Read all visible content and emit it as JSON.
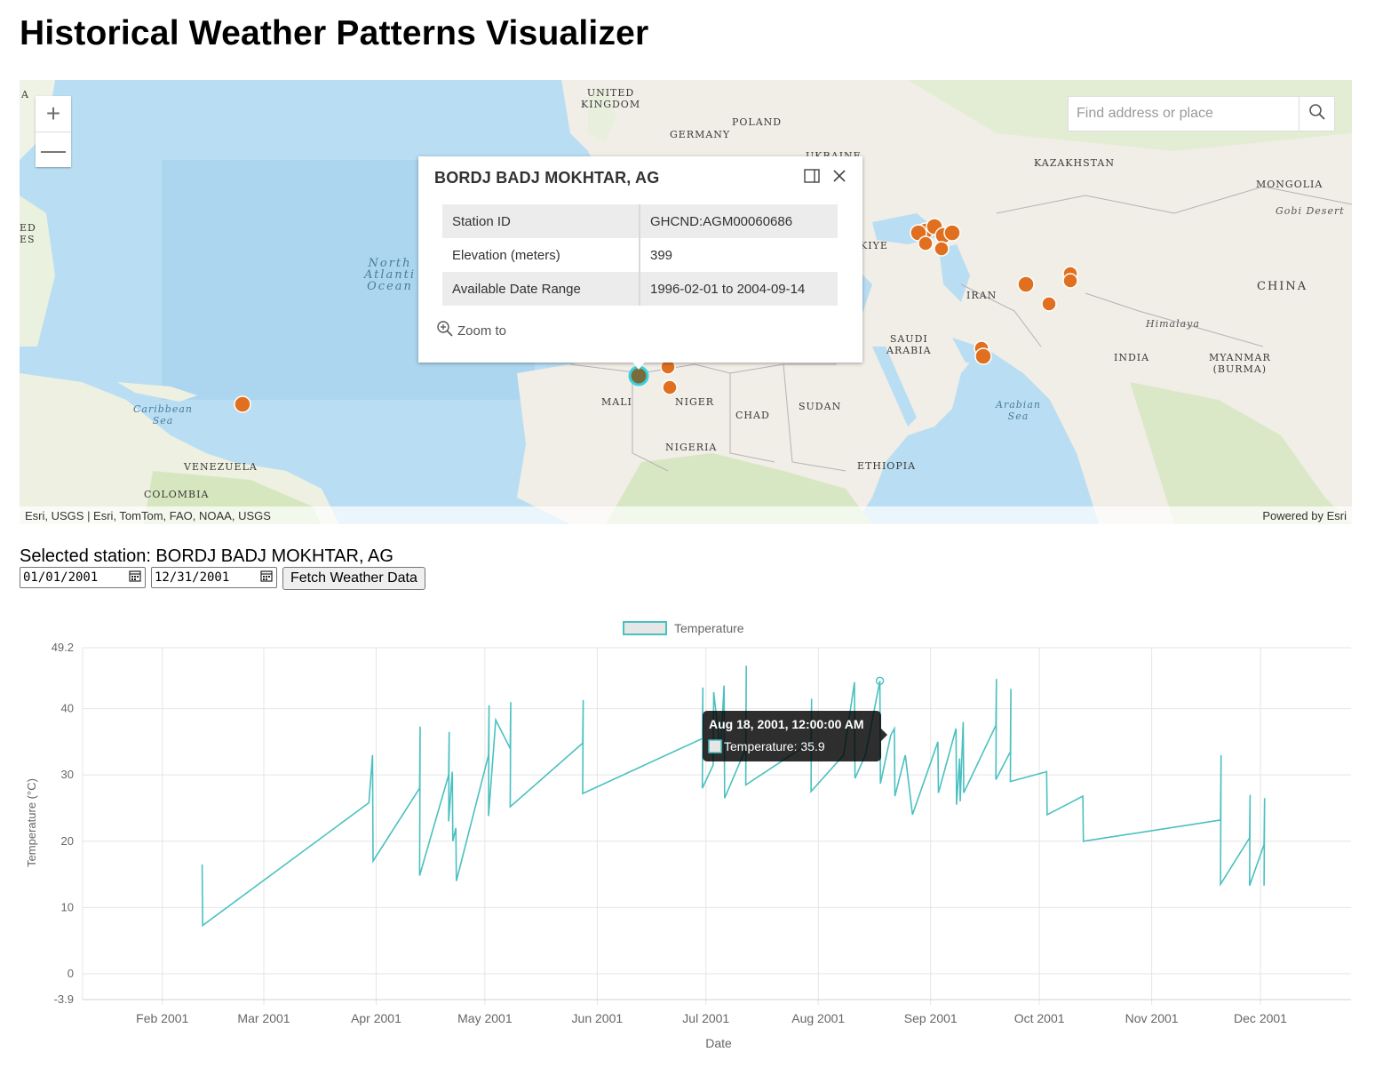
{
  "page": {
    "title": "Historical Weather Patterns Visualizer"
  },
  "map": {
    "zoom_in_label": "+",
    "zoom_out_label": "—",
    "search": {
      "placeholder": "Find address or place"
    },
    "attribution_left": "Esri, USGS | Esri, TomTom, FAO, NOAA, USGS",
    "attribution_right": "Powered by Esri",
    "labels": {
      "united_kingdom": "UNITED\nKINGDOM",
      "poland": "POLAND",
      "germany": "GERMANY",
      "ukraine": "UKRAINE",
      "kazakhstan": "KAZAKHSTAN",
      "mongolia": "MONGOLIA",
      "gobi": "Gobi Desert",
      "turkiye": "KIYE",
      "iran": "IRAN",
      "china": "CHINA",
      "himalaya": "Himalaya",
      "north_atlantic": "North\nAtlanti\nOcean",
      "saudi": "SAUDI\nARABIA",
      "india": "INDIA",
      "myanmar": "MYANMAR\n(BURMA)",
      "arabian_sea": "Arabian\nSea",
      "caribbean": "Caribbean\nSea",
      "mali": "MALI",
      "niger": "NIGER",
      "chad": "CHAD",
      "sudan": "SUDAN",
      "nigeria": "NIGERIA",
      "ethiopia": "ETHIOPIA",
      "venezuela": "VENEZUELA",
      "colombia": "COLOMBIA",
      "edge_a": "A",
      "edge_ed": "ED\nES"
    },
    "station_color": "#e07020",
    "popup": {
      "title": "BORDJ BADJ MOKHTAR, AG",
      "rows": [
        {
          "key": "Station ID",
          "value": "GHCND:AGM00060686"
        },
        {
          "key": "Elevation (meters)",
          "value": "399"
        },
        {
          "key": "Available Date Range",
          "value": "1996-02-01 to 2004-09-14"
        }
      ],
      "zoom_to": "Zoom to",
      "dock_icon": "dock-icon",
      "close_icon": "close-icon"
    }
  },
  "selection": {
    "label": "Selected station: BORDJ BADJ MOKHTAR, AG",
    "start_date": "01/01/2001",
    "end_date": "12/31/2001",
    "fetch_label": "Fetch Weather Data"
  },
  "chart_data": {
    "type": "line",
    "color": "#4bc0c0",
    "legend": "Temperature",
    "xlabel": "Date",
    "ylabel": "Temperature (°C)",
    "ylim": [
      -3.9,
      49.2
    ],
    "y_ticks": [
      "49.2",
      "40",
      "30",
      "20",
      "10",
      "0",
      "-3.9"
    ],
    "x_ticks": [
      "Feb 2001",
      "Mar 2001",
      "Apr 2001",
      "May 2001",
      "Jun 2001",
      "Jul 2001",
      "Aug 2001",
      "Sep 2001",
      "Oct 2001",
      "Nov 2001",
      "Dec 2001"
    ],
    "points": [
      [
        "2001-02-12",
        16.5
      ],
      [
        "2001-02-12",
        7.3
      ],
      [
        "2001-03-30",
        25.8
      ],
      [
        "2001-03-31",
        33.0
      ],
      [
        "2001-03-31",
        17.0
      ],
      [
        "2001-04-13",
        28.0
      ],
      [
        "2001-04-13",
        37.3
      ],
      [
        "2001-04-13",
        14.8
      ],
      [
        "2001-04-21",
        30.0
      ],
      [
        "2001-04-21",
        36.5
      ],
      [
        "2001-04-21",
        23.0
      ],
      [
        "2001-04-22",
        30.5
      ],
      [
        "2001-04-22",
        20.0
      ],
      [
        "2001-04-23",
        22.0
      ],
      [
        "2001-04-23",
        14.0
      ],
      [
        "2001-05-02",
        33.0
      ],
      [
        "2001-05-02",
        40.5
      ],
      [
        "2001-05-02",
        23.8
      ],
      [
        "2001-05-04",
        38.3
      ],
      [
        "2001-05-08",
        34.0
      ],
      [
        "2001-05-08",
        41.0
      ],
      [
        "2001-05-08",
        25.2
      ],
      [
        "2001-05-28",
        34.8
      ],
      [
        "2001-05-28",
        41.3
      ],
      [
        "2001-05-28",
        27.2
      ],
      [
        "2001-06-30",
        35.5
      ],
      [
        "2001-06-30",
        43.2
      ],
      [
        "2001-06-30",
        28.0
      ],
      [
        "2001-07-03",
        31.5
      ],
      [
        "2001-07-03",
        42.5
      ],
      [
        "2001-07-05",
        33.5
      ],
      [
        "2001-07-06",
        43.5
      ],
      [
        "2001-07-06",
        26.5
      ],
      [
        "2001-07-12",
        34.0
      ],
      [
        "2001-07-12",
        46.5
      ],
      [
        "2001-07-12",
        28.5
      ],
      [
        "2001-07-30",
        35.0
      ],
      [
        "2001-07-30",
        41.5
      ],
      [
        "2001-07-30",
        27.5
      ],
      [
        "2001-08-08",
        33.0
      ],
      [
        "2001-08-11",
        44.0
      ],
      [
        "2001-08-11",
        29.5
      ],
      [
        "2001-08-14",
        33.0
      ],
      [
        "2001-08-18",
        44.2
      ],
      [
        "2001-08-18",
        28.7
      ],
      [
        "2001-08-21",
        36.0
      ],
      [
        "2001-08-22",
        37.0
      ],
      [
        "2001-08-22",
        26.8
      ],
      [
        "2001-08-25",
        33.0
      ],
      [
        "2001-08-27",
        24.0
      ],
      [
        "2001-09-03",
        35.0
      ],
      [
        "2001-09-03",
        27.3
      ],
      [
        "2001-09-08",
        37.0
      ],
      [
        "2001-09-08",
        25.5
      ],
      [
        "2001-09-09",
        32.5
      ],
      [
        "2001-09-09",
        26.0
      ],
      [
        "2001-09-10",
        38.0
      ],
      [
        "2001-09-10",
        27.3
      ],
      [
        "2001-09-19",
        37.5
      ],
      [
        "2001-09-19",
        44.5
      ],
      [
        "2001-09-19",
        29.3
      ],
      [
        "2001-09-23",
        33.5
      ],
      [
        "2001-09-23",
        43.0
      ],
      [
        "2001-09-23",
        29.0
      ],
      [
        "2001-10-03",
        30.5
      ],
      [
        "2001-10-03",
        24.0
      ],
      [
        "2001-10-13",
        26.8
      ],
      [
        "2001-10-13",
        20.0
      ],
      [
        "2001-11-20",
        23.2
      ],
      [
        "2001-11-20",
        33.0
      ],
      [
        "2001-11-20",
        13.5
      ],
      [
        "2001-11-28",
        20.5
      ],
      [
        "2001-11-28",
        27.0
      ],
      [
        "2001-11-28",
        13.3
      ],
      [
        "2001-12-02",
        19.5
      ],
      [
        "2001-12-02",
        26.5
      ],
      [
        "2001-12-02",
        13.3
      ]
    ],
    "tooltip": {
      "title": "Aug 18, 2001, 12:00:00 AM",
      "label": "Temperature: 35.9"
    }
  }
}
